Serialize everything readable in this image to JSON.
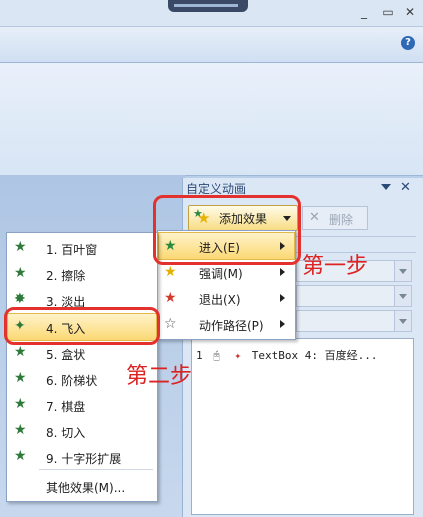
{
  "window": {
    "minimize_glyph": "_",
    "restore_glyph": "▭",
    "close_glyph": "✕",
    "help_glyph": "?"
  },
  "task_pane": {
    "title": "自定义动画",
    "close_glyph": "✕",
    "add_effect_label": "添加效果",
    "remove_label": "删除",
    "animation_item": {
      "number": "1",
      "text": "TextBox 4: 百度经..."
    }
  },
  "enter_menu": {
    "items": [
      {
        "label": "进入(E)",
        "icon": "green-star-icon",
        "selected": true
      },
      {
        "label": "强调(M)",
        "icon": "yellow-star-icon",
        "selected": false
      },
      {
        "label": "退出(X)",
        "icon": "red-star-icon",
        "selected": false
      },
      {
        "label": "动作路径(P)",
        "icon": "outline-star-icon",
        "selected": false
      }
    ]
  },
  "entrance_submenu": {
    "items": [
      {
        "label": "1. 百叶窗",
        "selected": false
      },
      {
        "label": "2. 擦除",
        "selected": false
      },
      {
        "label": "3. 淡出",
        "selected": false
      },
      {
        "label": "4. 飞入",
        "selected": true
      },
      {
        "label": "5. 盒状",
        "selected": false
      },
      {
        "label": "6. 阶梯状",
        "selected": false
      },
      {
        "label": "7. 棋盘",
        "selected": false
      },
      {
        "label": "8. 切入",
        "selected": false
      },
      {
        "label": "9. 十字形扩展",
        "selected": false
      }
    ],
    "more_label": "其他效果(M)..."
  },
  "annotations": {
    "step1": "第一步",
    "step2": "第二步",
    "color": "#e3322e"
  },
  "colors": {
    "highlight": "#fbd874",
    "pane_bg": "#dce7f5"
  }
}
